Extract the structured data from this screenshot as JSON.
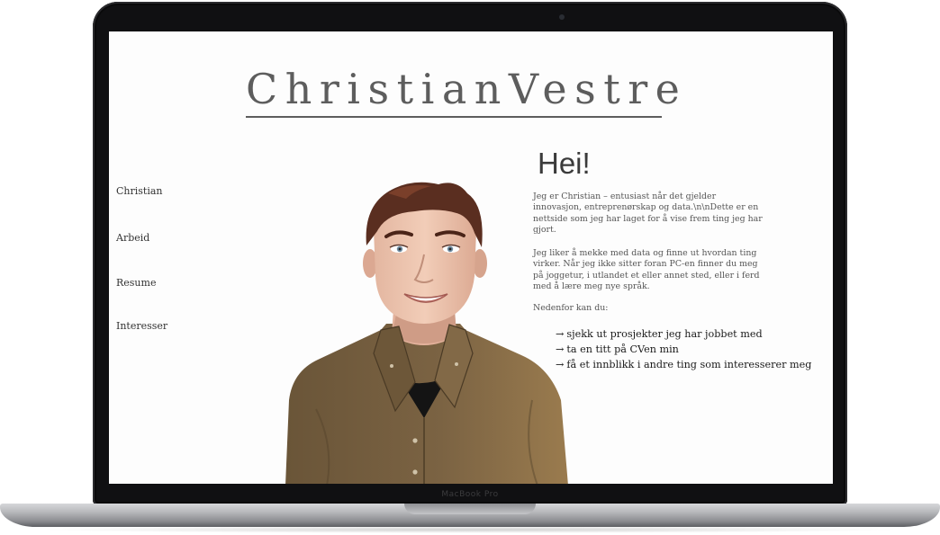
{
  "device": {
    "chin_label": "MacBook Pro"
  },
  "site": {
    "title": "ChristianVestre"
  },
  "nav": {
    "items": [
      {
        "label": "Christian"
      },
      {
        "label": "Arbeid"
      },
      {
        "label": "Resume"
      },
      {
        "label": "Interesser"
      }
    ]
  },
  "intro": {
    "heading": "Hei!",
    "paragraph1": "Jeg er Christian – entusiast når det gjelder\ninnovasjon, entreprenørskap og data.\\n\\nDette er en\nnettside som jeg har laget for å vise frem ting jeg har\ngjort.",
    "paragraph2": "Jeg liker å mekke med data og finne ut hvordan ting\nvirker. Når jeg ikke sitter foran PC-en finner du meg\npå joggetur, i utlandet et eller annet sted, eller i ferd\nmed å lære meg nye språk.",
    "paragraph3": "Nedenfor kan du:",
    "arrow": "→",
    "links": [
      {
        "label": "sjekk ut prosjekter jeg har jobbet med"
      },
      {
        "label": "ta en titt på CVen min"
      },
      {
        "label": "få et innblikk i andre ting som interesserer meg"
      }
    ]
  },
  "colors": {
    "title": "#5d5d5d",
    "shirt": "#7a6241",
    "hair": "#5a2e20",
    "frame": "#101012"
  },
  "icons": {
    "portrait": "portrait-illustration",
    "camera": "camera-icon"
  }
}
